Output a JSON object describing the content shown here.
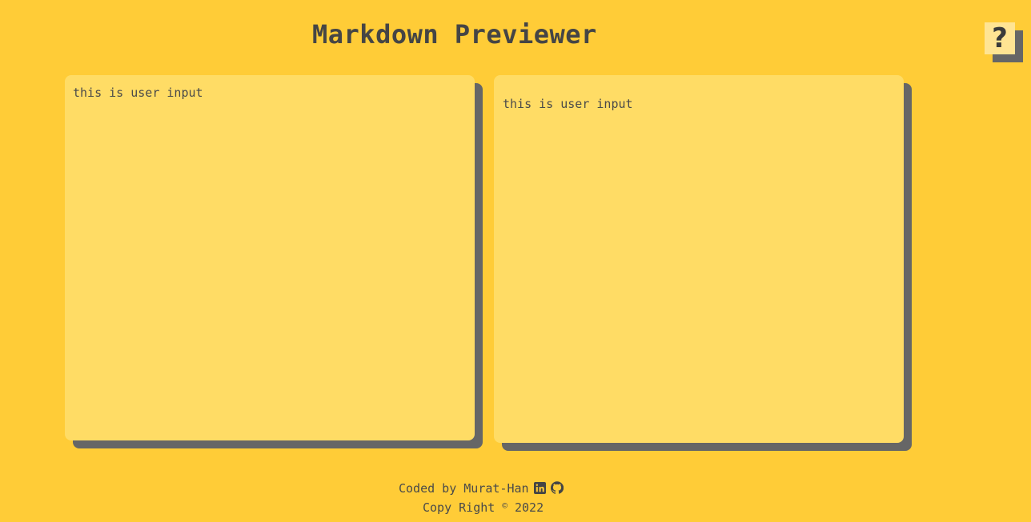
{
  "header": {
    "title": "Markdown Previewer",
    "help_label": "?"
  },
  "editor": {
    "value": "this is user input"
  },
  "preview": {
    "text": "this is user input"
  },
  "footer": {
    "coded_by": "Coded by Murat-Han",
    "copyright_prefix": "Copy Right",
    "copyright_symbol": "©",
    "copyright_year": "2022",
    "icons": [
      "linkedin-icon",
      "github-icon"
    ]
  },
  "colors": {
    "background": "#ffcc37",
    "panel": "#ffdc65",
    "shadow": "#666666",
    "text": "#454545",
    "help_button": "#ffe493"
  }
}
